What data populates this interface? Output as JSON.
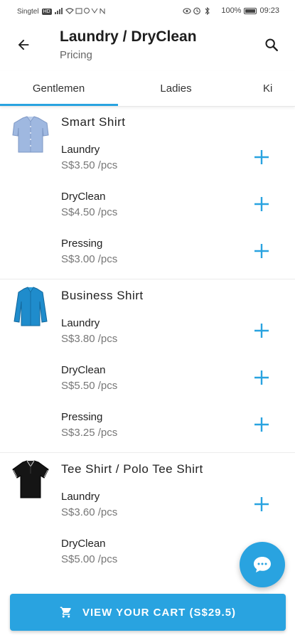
{
  "status_bar": {
    "carrier": "Singtel",
    "network_badge": "HD",
    "battery_percent": "100%",
    "time": "09:23"
  },
  "header": {
    "title": "Laundry / DryClean",
    "subtitle": "Pricing",
    "back_icon": "arrow-left-icon",
    "search_icon": "search-icon"
  },
  "tabs": [
    {
      "label": "Gentlemen",
      "selected": true
    },
    {
      "label": "Ladies",
      "selected": false
    },
    {
      "label": "Ki",
      "selected": false
    }
  ],
  "items": [
    {
      "name": "Smart Shirt",
      "image": "light-blue-shirt",
      "services": [
        {
          "name": "Laundry",
          "price": "S$3.50 /pcs"
        },
        {
          "name": "DryClean",
          "price": "S$4.50 /pcs"
        },
        {
          "name": "Pressing",
          "price": "S$3.00 /pcs"
        }
      ]
    },
    {
      "name": "Business Shirt",
      "image": "blue-shirt",
      "services": [
        {
          "name": "Laundry",
          "price": "S$3.80 /pcs"
        },
        {
          "name": "DryClean",
          "price": "S$5.50 /pcs"
        },
        {
          "name": "Pressing",
          "price": "S$3.25 /pcs"
        }
      ]
    },
    {
      "name": "Tee Shirt / Polo Tee Shirt",
      "image": "black-polo-shirt",
      "services": [
        {
          "name": "Laundry",
          "price": "S$3.60 /pcs"
        },
        {
          "name": "DryClean",
          "price": "S$5.00 /pcs"
        }
      ]
    }
  ],
  "fab": {
    "icon": "chat-bubble-icon"
  },
  "cart": {
    "label": "VIEW YOUR CART (S$29.5)",
    "icon": "shopping-cart-icon"
  },
  "colors": {
    "accent": "#29a3e0",
    "text": "#222222",
    "muted": "#777777"
  }
}
